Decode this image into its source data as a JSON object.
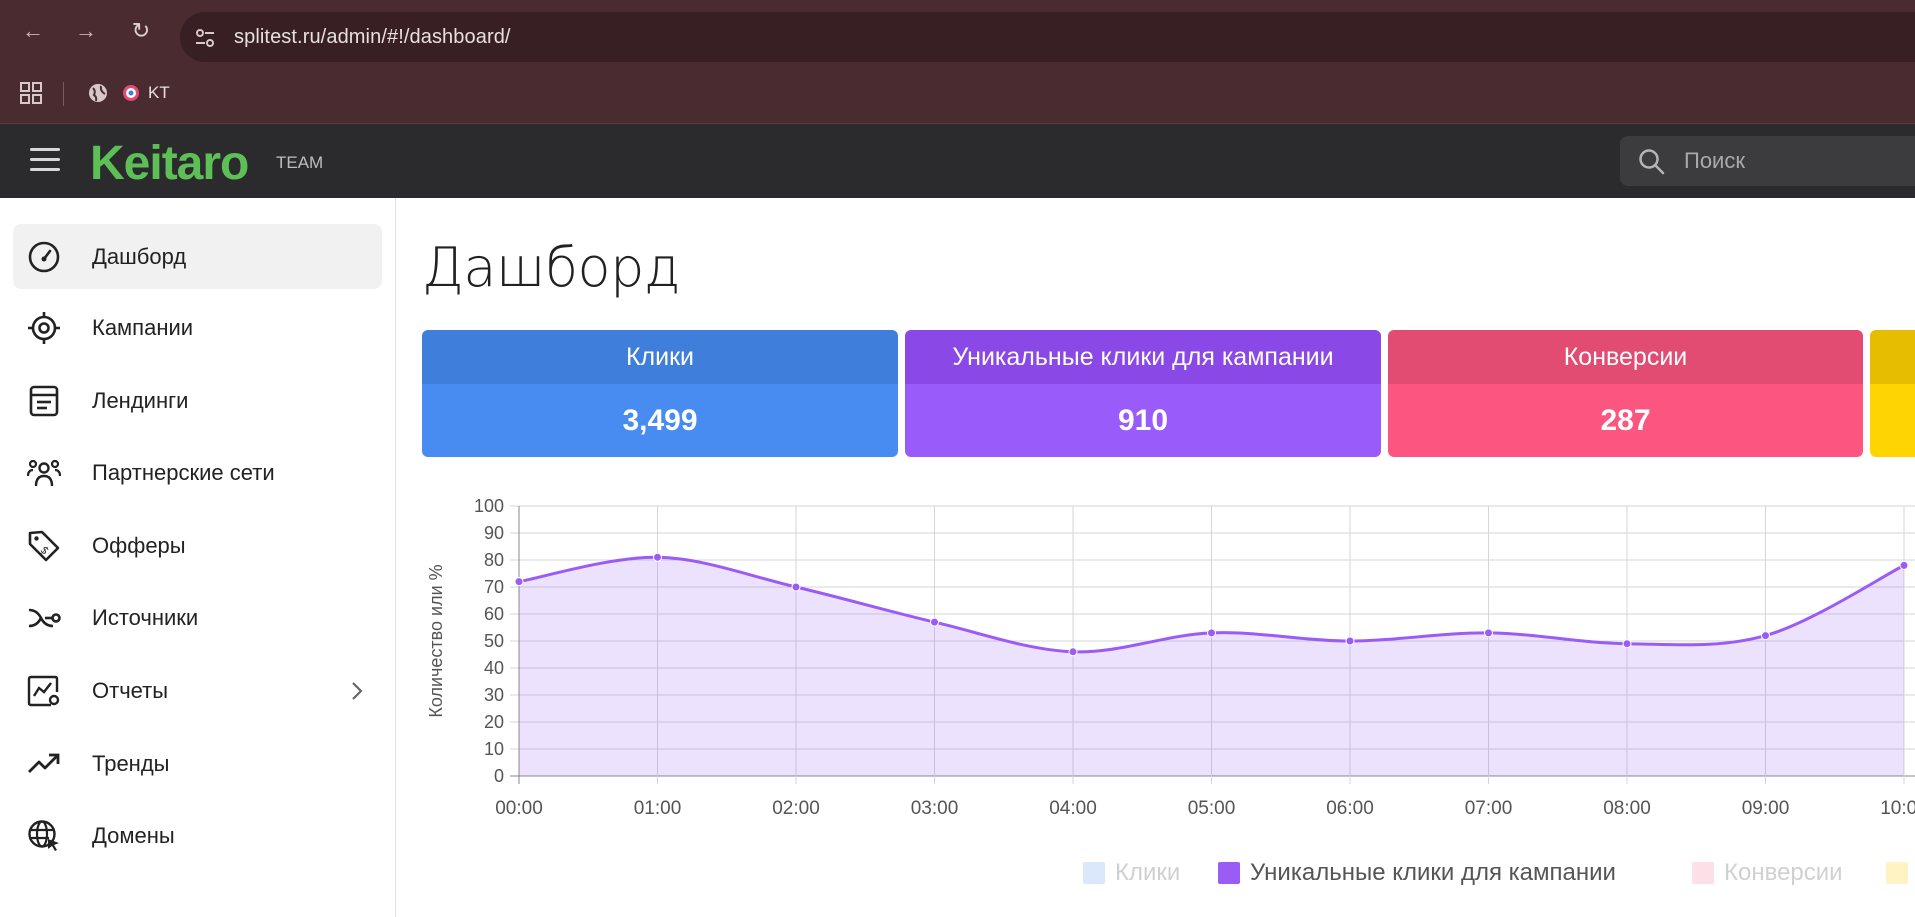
{
  "browser": {
    "url": "splitest.ru/admin/#!/dashboard/",
    "bookmark_label": "KT"
  },
  "header": {
    "logo": "Keitaro",
    "edition": "TEAM",
    "search_placeholder": "Поиск"
  },
  "sidebar": {
    "items": [
      {
        "label": "Дашборд",
        "icon": "dashboard-icon",
        "active": true
      },
      {
        "label": "Кампании",
        "icon": "target-icon"
      },
      {
        "label": "Лендинги",
        "icon": "document-icon"
      },
      {
        "label": "Партнерские сети",
        "icon": "group-icon"
      },
      {
        "label": "Офферы",
        "icon": "price-tag-icon"
      },
      {
        "label": "Источники",
        "icon": "route-icon"
      },
      {
        "label": "Отчеты",
        "icon": "report-chart-icon",
        "has_submenu": true
      },
      {
        "label": "Тренды",
        "icon": "trend-icon"
      },
      {
        "label": "Домены",
        "icon": "globe-cursor-icon"
      }
    ]
  },
  "main": {
    "title": "Дашборд",
    "cards": [
      {
        "label": "Клики",
        "value": "3,499",
        "head_color": "#3f7fdb",
        "body_color": "#488cf2"
      },
      {
        "label": "Уникальные клики для кампании",
        "value": "910",
        "head_color": "#8a48e6",
        "body_color": "#9a5bfb"
      },
      {
        "label": "Конверсии",
        "value": "287",
        "head_color": "#e24b72",
        "body_color": "#fb5580"
      },
      {
        "label": "",
        "value": "",
        "head_color": "#e6bd00",
        "body_color": "#ffd500"
      }
    ]
  },
  "chart_data": {
    "type": "area",
    "x": [
      "00:00",
      "01:00",
      "02:00",
      "03:00",
      "04:00",
      "05:00",
      "06:00",
      "07:00",
      "08:00",
      "09:00",
      "10:00"
    ],
    "series": [
      {
        "name": "Уникальные клики для кампании",
        "values": [
          72,
          81,
          70,
          57,
          46,
          53,
          50,
          53,
          49,
          52,
          78
        ],
        "color": "#9b5cf6"
      }
    ],
    "ylabel": "Количество или %",
    "ylim": [
      0,
      100
    ],
    "yticks": [
      0,
      10,
      20,
      30,
      40,
      50,
      60,
      70,
      80,
      90,
      100
    ],
    "grid": true,
    "legend": [
      {
        "name": "Клики",
        "color": "#dbe7fb",
        "active": false
      },
      {
        "name": "Уникальные клики для кампании",
        "color": "#9b5cf6",
        "active": true
      },
      {
        "name": "Конверсии",
        "color": "#fde0e7",
        "active": false
      },
      {
        "name": "",
        "color": "#fff3c4",
        "active": false
      }
    ]
  }
}
